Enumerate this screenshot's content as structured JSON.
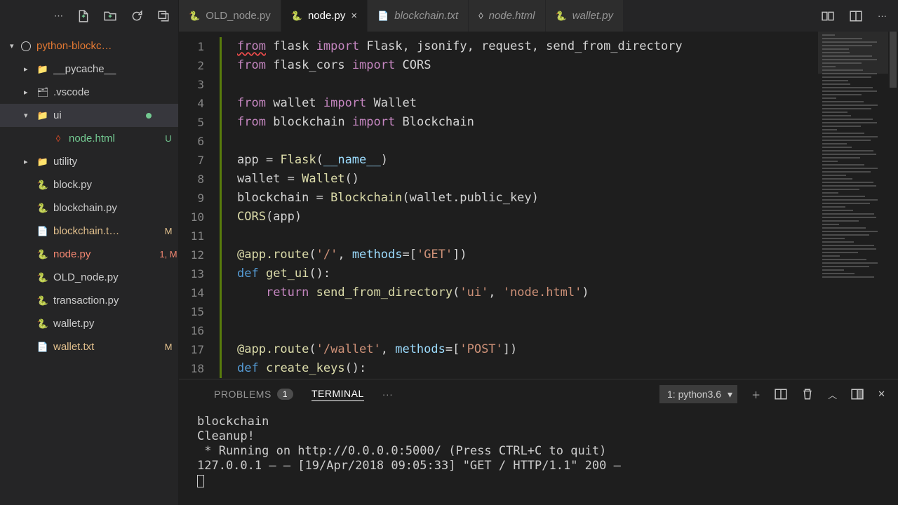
{
  "sidebar": {
    "root_label": "python-blockc…",
    "items": [
      {
        "name": "__pycache__",
        "icon": "📁",
        "kind": "folder",
        "chev": "closed",
        "indent": 1
      },
      {
        "name": ".vscode",
        "icon": "🗂",
        "kind": "folder",
        "chev": "closed",
        "indent": 1
      },
      {
        "name": "ui",
        "icon": "📁",
        "kind": "folder",
        "chev": "open",
        "indent": 1,
        "status": "",
        "dot": true,
        "selected": true
      },
      {
        "name": "node.html",
        "icon": "◊",
        "iconColor": "#e44d26",
        "kind": "file",
        "indent": 2,
        "status": "U",
        "git": "u"
      },
      {
        "name": "utility",
        "icon": "📁",
        "kind": "folder",
        "chev": "closed",
        "indent": 1
      },
      {
        "name": "block.py",
        "icon": "🐍",
        "kind": "file",
        "indent": 1
      },
      {
        "name": "blockchain.py",
        "icon": "🐍",
        "kind": "file",
        "indent": 1
      },
      {
        "name": "blockchain.t…",
        "icon": "📄",
        "kind": "file",
        "indent": 1,
        "status": "M",
        "git": "m"
      },
      {
        "name": "node.py",
        "icon": "🐍",
        "kind": "file",
        "indent": 1,
        "status": "1, M",
        "git": "err"
      },
      {
        "name": "OLD_node.py",
        "icon": "🐍",
        "kind": "file",
        "indent": 1
      },
      {
        "name": "transaction.py",
        "icon": "🐍",
        "kind": "file",
        "indent": 1
      },
      {
        "name": "wallet.py",
        "icon": "🐍",
        "kind": "file",
        "indent": 1
      },
      {
        "name": "wallet.txt",
        "icon": "📄",
        "kind": "file",
        "indent": 1,
        "status": "M",
        "git": "m"
      }
    ]
  },
  "tabs": [
    {
      "label": "OLD_node.py",
      "icon": "🐍",
      "active": false
    },
    {
      "label": "node.py",
      "icon": "🐍",
      "active": true,
      "close": "×"
    },
    {
      "label": "blockchain.txt",
      "icon": "📄",
      "active": false,
      "ital": true
    },
    {
      "label": "node.html",
      "icon": "◊",
      "active": false,
      "ital": true
    },
    {
      "label": "wallet.py",
      "icon": "🐍",
      "active": false,
      "ital": true
    }
  ],
  "code": {
    "lines": [
      {
        "n": 1,
        "html": "<span class='k-from from-squiggle'>from</span> <span class='plain'>flask</span> <span class='k-import'>import</span> <span class='plain'>Flask, jsonify, request, send_from_directory</span>"
      },
      {
        "n": 2,
        "html": "<span class='k-from'>from</span> <span class='plain'>flask_cors</span> <span class='k-import'>import</span> <span class='plain'>CORS</span>"
      },
      {
        "n": 3,
        "html": ""
      },
      {
        "n": 4,
        "html": "<span class='k-from'>from</span> <span class='plain'>wallet</span> <span class='k-import'>import</span> <span class='plain'>Wallet</span>"
      },
      {
        "n": 5,
        "html": "<span class='k-from'>from</span> <span class='plain'>blockchain</span> <span class='k-import'>import</span> <span class='plain'>Blockchain</span>"
      },
      {
        "n": 6,
        "html": ""
      },
      {
        "n": 7,
        "html": "<span class='plain'>app = </span><span class='fn'>Flask</span><span class='plain'>(</span><span class='dunder'>__name__</span><span class='plain'>)</span>"
      },
      {
        "n": 8,
        "html": "<span class='plain'>wallet = </span><span class='fn'>Wallet</span><span class='plain'>()</span>"
      },
      {
        "n": 9,
        "html": "<span class='plain'>blockchain = </span><span class='fn'>Blockchain</span><span class='plain'>(wallet.public_key)</span>"
      },
      {
        "n": 10,
        "html": "<span class='fn'>CORS</span><span class='plain'>(app)</span>"
      },
      {
        "n": 11,
        "html": ""
      },
      {
        "n": 12,
        "html": "<span class='dec'>@app.route</span><span class='plain'>(</span><span class='str'>'/'</span><span class='plain'>, </span><span class='var'>methods</span><span class='plain'>=[</span><span class='str'>'GET'</span><span class='plain'>])</span>"
      },
      {
        "n": 13,
        "html": "<span class='k-def'>def</span> <span class='fn'>get_ui</span><span class='plain'>():</span>"
      },
      {
        "n": 14,
        "html": "    <span class='k-return'>return</span> <span class='fn'>send_from_directory</span><span class='plain'>(</span><span class='str'>'ui'</span><span class='plain'>, </span><span class='str'>'node.html'</span><span class='plain'>)</span>"
      },
      {
        "n": 15,
        "html": ""
      },
      {
        "n": 16,
        "html": ""
      },
      {
        "n": 17,
        "html": "<span class='dec'>@app.route</span><span class='plain'>(</span><span class='str'>'/wallet'</span><span class='plain'>, </span><span class='var'>methods</span><span class='plain'>=[</span><span class='str'>'POST'</span><span class='plain'>])</span>"
      },
      {
        "n": 18,
        "html": "<span class='k-def'>def</span> <span class='fn'>create_keys</span><span class='plain'>():</span>"
      }
    ]
  },
  "panel": {
    "tabs": {
      "problems": "PROBLEMS",
      "problems_count": "1",
      "terminal": "TERMINAL",
      "more": "···"
    },
    "select": "1: python3.6",
    "terminal_lines": "blockchain\nCleanup!\n * Running on http://0.0.0.0:5000/ (Press CTRL+C to quit)\n127.0.0.1 – – [19/Apr/2018 09:05:33] \"GET / HTTP/1.1\" 200 –"
  }
}
